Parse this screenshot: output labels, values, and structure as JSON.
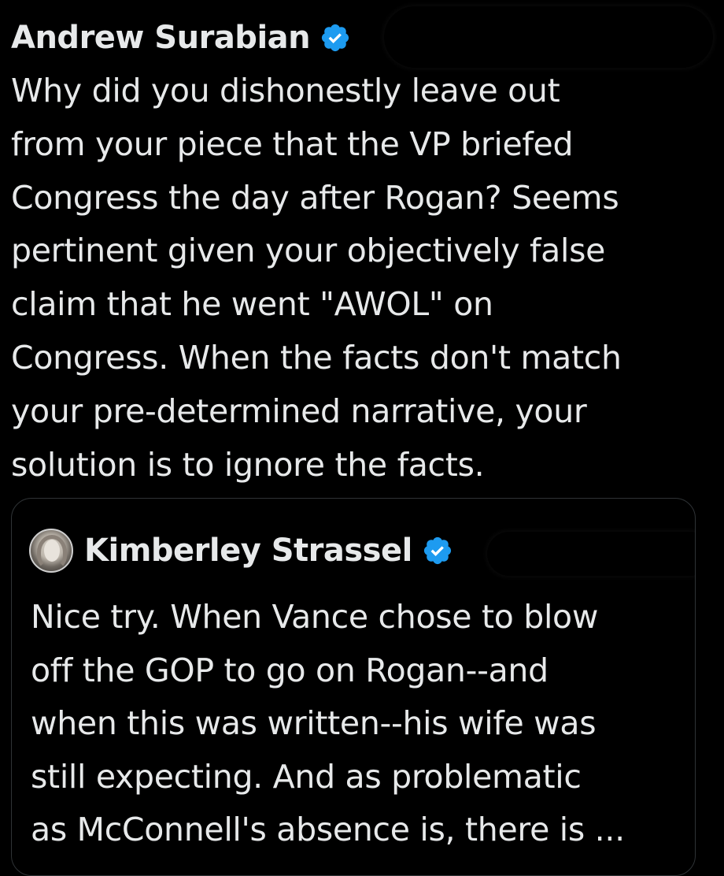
{
  "tweet": {
    "author_name": "Andrew Surabian",
    "verified_icon": "verified-badge-icon",
    "text": "Why did you dishonestly leave out\nfrom your piece that the VP briefed\nCongress the day after Rogan? Seems\npertinent given your objectively false\nclaim that he went \"AWOL\" on\nCongress. When the facts don't match\nyour pre-determined narrative, your\nsolution is to ignore the facts."
  },
  "quoted_tweet": {
    "author_name": "Kimberley Strassel",
    "verified_icon": "verified-badge-icon",
    "avatar_icon": "profile-photo",
    "text": "Nice try. When Vance chose to blow\noff the GOP to go on Rogan--and\nwhen this was written--his wife was\nstill expecting. And as problematic\nas McConnell's absence is, there is ..."
  },
  "colors": {
    "background": "#000000",
    "text": "#e7e9ea",
    "verified_blue": "#1d9bf0",
    "card_border": "#2f3336"
  }
}
